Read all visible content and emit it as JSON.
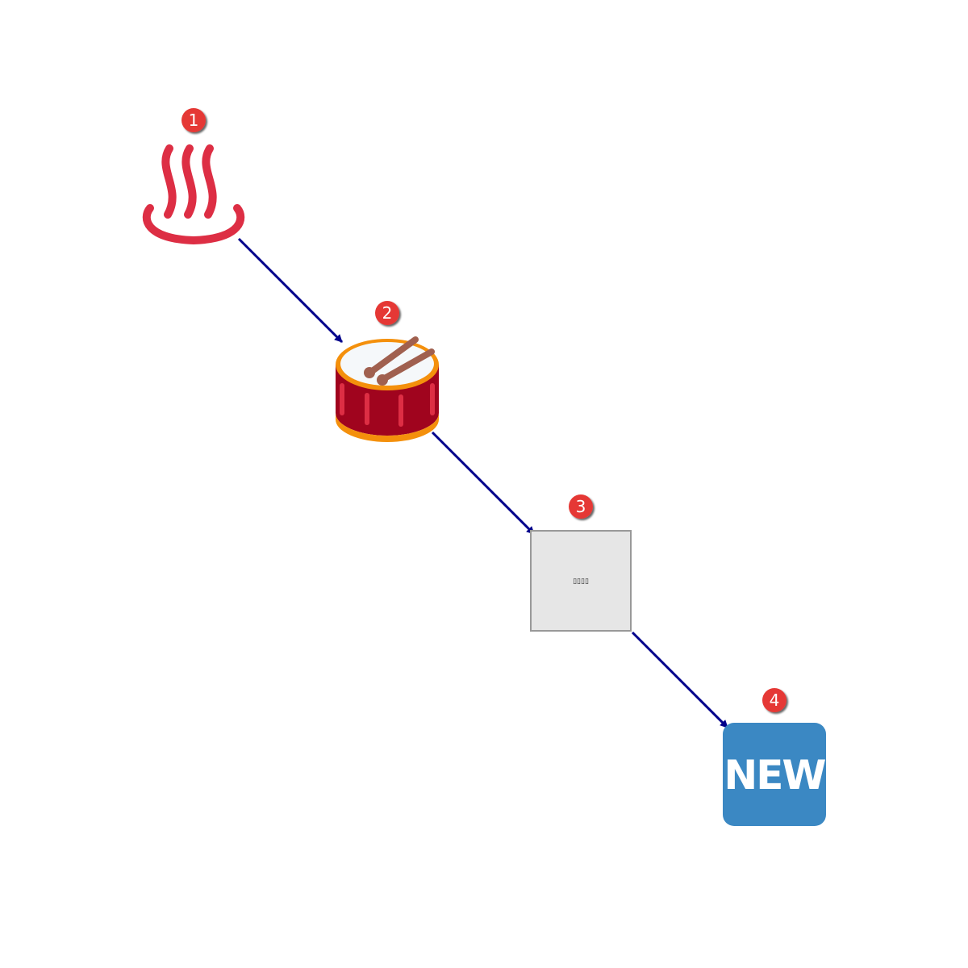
{
  "steps": [
    {
      "number": "1",
      "icon": "hot-springs-icon"
    },
    {
      "number": "2",
      "icon": "drum-icon"
    },
    {
      "number": "3",
      "icon": "missing-glyph-placeholder",
      "label": "▯▯▯▯"
    },
    {
      "number": "4",
      "icon": "new-button-icon",
      "label": "NEW"
    }
  ],
  "colors": {
    "arrow": "#00008b",
    "badge": "#e53935",
    "hot_springs": "#dd2e44",
    "drum_body": "#a0041e",
    "drum_rim": "#f4900c",
    "drumstick": "#a0604f",
    "placeholder_fill": "#e6e6e6",
    "placeholder_border": "#999999",
    "new_fill": "#3b88c3"
  }
}
